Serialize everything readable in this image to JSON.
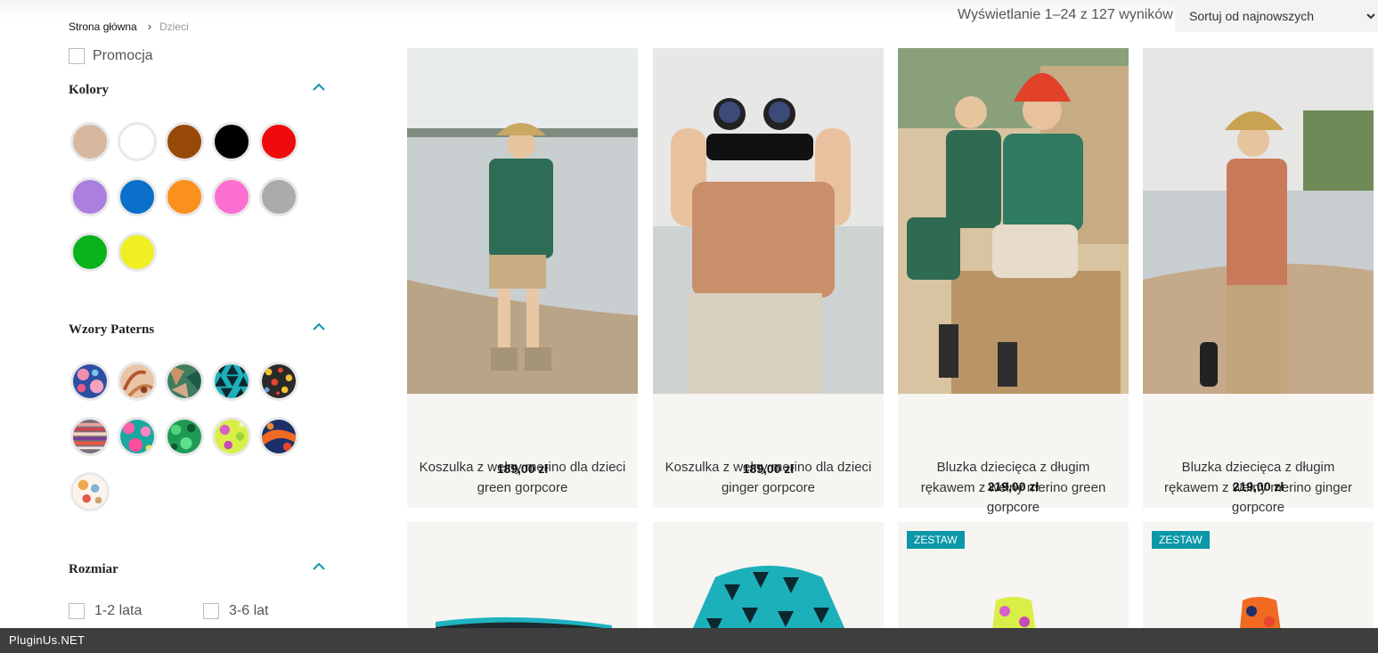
{
  "breadcrumb": {
    "home": "Strona główna",
    "separator": "›",
    "current": "Dzieci"
  },
  "results": {
    "count_text": "Wyświetlanie 1–24 z 127 wyników"
  },
  "sort": {
    "selected": "Sortuj od najnowszych"
  },
  "filters": {
    "promo_label": "Promocja",
    "colors": {
      "title": "Kolory",
      "swatches": [
        "#d6b7a0",
        "#ffffff",
        "#974908",
        "#000000",
        "#ef0b0b",
        "#ab7ee0",
        "#0a70c9",
        "#fb911d",
        "#fd6ed2",
        "#ababab",
        "#0ab21c",
        "#efef24"
      ]
    },
    "patterns": {
      "title": "Wzory Paterns",
      "items": [
        "pattern-floral-blue",
        "pattern-leaves-peach",
        "pattern-green-gorpcore",
        "pattern-teal-triangles",
        "pattern-confetti-dark",
        "pattern-stripes",
        "pattern-pink-blobs",
        "pattern-green-blobs",
        "pattern-lime-blobs",
        "pattern-orange-navy",
        "pattern-pastel-mix"
      ]
    },
    "sizes": {
      "title": "Rozmiar",
      "options": [
        "1-2 lata",
        "3-6 lat"
      ]
    }
  },
  "products": [
    {
      "title": "Koszulka z wełny merino dla dzieci green gorpcore",
      "price": "189,00 zł"
    },
    {
      "title": "Koszulka z wełny merino dla dzieci ginger gorpcore",
      "price": "189,00 zł"
    },
    {
      "title": "Bluzka dziecięca z długim rękawem z wełny merino green gorpcore",
      "price": "219,00 zł"
    },
    {
      "title": "Bluzka dziecięca z długim rękawem z wełny merino ginger gorpcore",
      "price": "219,00 zł"
    }
  ],
  "products_row2": {
    "badge": "ZESTAW"
  },
  "footer": {
    "label": "PluginUs.NET"
  },
  "colors": {
    "accent": "#0a97a8",
    "card_bg": "#f7f5f2",
    "bottom_bar": "#3e3e3e"
  }
}
